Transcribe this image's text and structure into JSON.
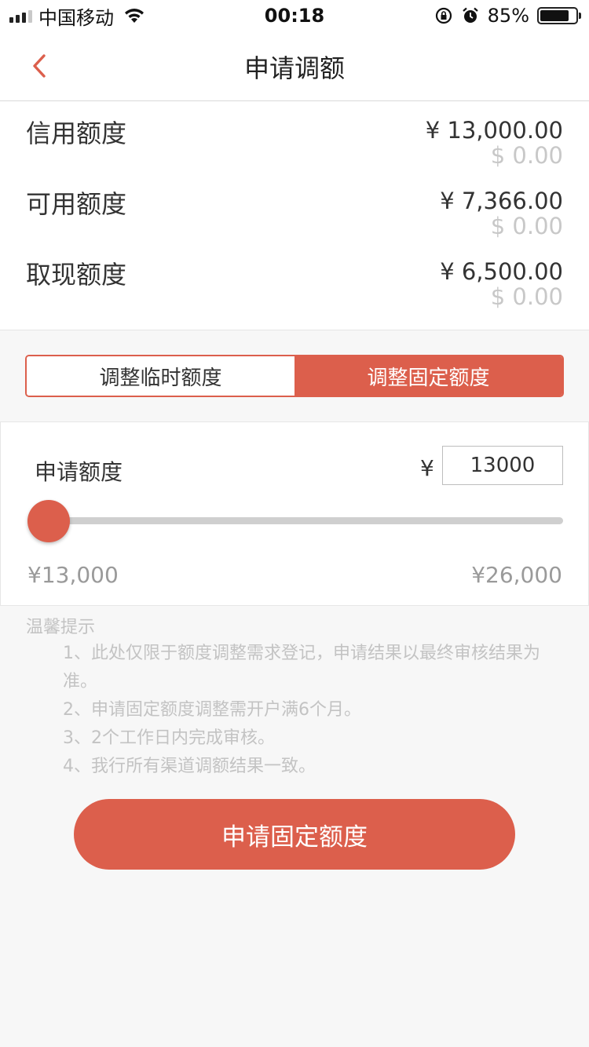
{
  "status_bar": {
    "carrier": "中国移动",
    "time": "00:18",
    "battery": "85%"
  },
  "nav": {
    "title": "申请调额",
    "back_icon": "chevron-left-icon"
  },
  "limits": [
    {
      "label": "信用额度",
      "cny": "¥ 13,000.00",
      "usd": "$ 0.00"
    },
    {
      "label": "可用额度",
      "cny": "¥ 7,366.00",
      "usd": "$ 0.00"
    },
    {
      "label": "取现额度",
      "cny": "¥ 6,500.00",
      "usd": "$ 0.00"
    }
  ],
  "tabs": [
    {
      "label": "调整临时额度",
      "active": false
    },
    {
      "label": "调整固定额度",
      "active": true
    }
  ],
  "apply": {
    "label": "申请额度",
    "currency": "¥",
    "amount": "13000",
    "slider_value": 0,
    "min_label": "¥13,000",
    "max_label": "¥26,000"
  },
  "tips": {
    "title": "温馨提示",
    "items": [
      "1、此处仅限于额度调整需求登记，申请结果以最终审核结果为准。",
      "2、申请固定额度调整需开户满6个月。",
      "3、2个工作日内完成审核。",
      "4、我行所有渠道调额结果一致。"
    ]
  },
  "submit_label": "申请固定额度",
  "colors": {
    "accent": "#dc5f4c",
    "muted": "#c3c3c3"
  }
}
